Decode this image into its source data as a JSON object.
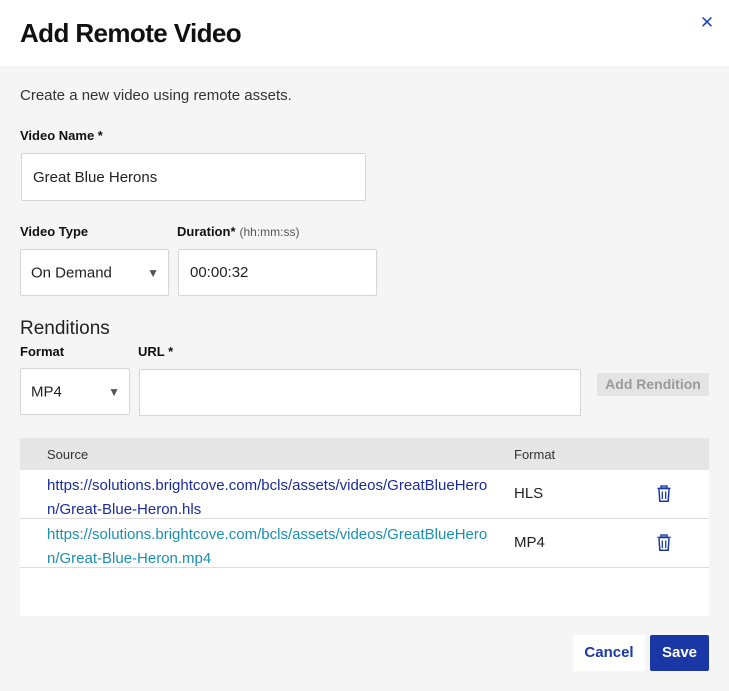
{
  "dialog": {
    "title": "Add Remote Video",
    "subtitle": "Create a new video using remote assets."
  },
  "form": {
    "video_name_label": "Video Name *",
    "video_name_value": "Great Blue Herons",
    "video_type_label": "Video Type",
    "video_type_value": "On Demand",
    "duration_label": "Duration*",
    "duration_hint": "(hh:mm:ss)",
    "duration_value": "00:00:32"
  },
  "renditions": {
    "section_title": "Renditions",
    "format_label": "Format",
    "format_value": "MP4",
    "url_label": "URL *",
    "url_value": "",
    "add_button": "Add Rendition"
  },
  "table": {
    "headers": {
      "source": "Source",
      "format": "Format"
    },
    "rows": [
      {
        "source": "https://solutions.brightcove.com/bcls/assets/videos/GreatBlueHeron/Great-Blue-Heron.hls",
        "format": "HLS",
        "link_color": "#1a2c9c"
      },
      {
        "source": "https://solutions.brightcove.com/bcls/assets/videos/GreatBlueHeron/Great-Blue-Heron.mp4",
        "format": "MP4",
        "link_color": "#1b8fb0"
      }
    ],
    "row_icon": "trash-icon"
  },
  "footer": {
    "cancel_label": "Cancel",
    "save_label": "Save"
  },
  "colors": {
    "accent": "#1a38a5",
    "close_icon": "#2a4bb8",
    "link_primary": "#1a2c9c",
    "link_secondary": "#1b8fb0"
  }
}
